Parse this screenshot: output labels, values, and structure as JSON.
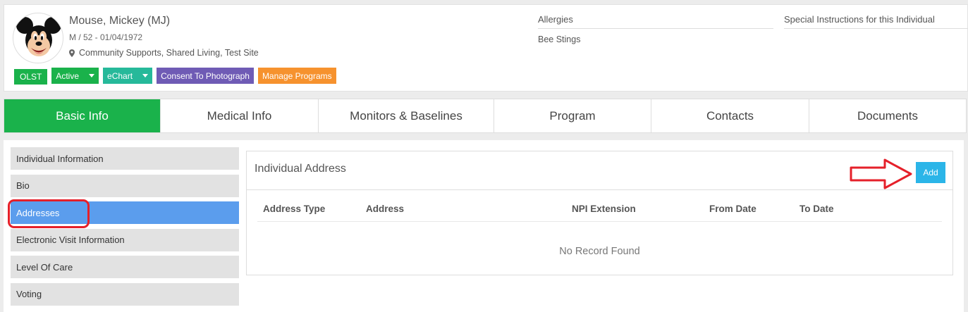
{
  "patient": {
    "name": "Mouse, Mickey (MJ)",
    "demographics": "M  /  52 - 01/04/1972",
    "location": "Community Supports, Shared Living, Test Site"
  },
  "badges": {
    "olst": "OLST",
    "active": "Active",
    "echart": "eChart",
    "consent": "Consent To Photograph",
    "manage": "Manage Programs"
  },
  "allergies": {
    "label": "Allergies",
    "value": "Bee Stings"
  },
  "special_instructions": {
    "label": "Special Instructions for this Individual"
  },
  "tabs": [
    {
      "label": "Basic Info",
      "active": true
    },
    {
      "label": "Medical Info"
    },
    {
      "label": "Monitors & Baselines"
    },
    {
      "label": "Program"
    },
    {
      "label": "Contacts"
    },
    {
      "label": "Documents"
    }
  ],
  "sidebar": {
    "items": [
      {
        "label": "Individual Information"
      },
      {
        "label": "Bio"
      },
      {
        "label": "Addresses",
        "active": true
      },
      {
        "label": "Electronic Visit Information"
      },
      {
        "label": "Level Of Care"
      },
      {
        "label": "Voting"
      }
    ]
  },
  "panel": {
    "title": "Individual Address",
    "add_label": "Add",
    "columns": [
      "Address Type",
      "Address",
      "NPI Extension",
      "From Date",
      "To Date"
    ],
    "empty_text": "No Record Found"
  },
  "colors": {
    "green": "#1ab24b",
    "teal": "#26b99a",
    "purple": "#6f5bb5",
    "orange": "#f6922e",
    "active_sidebar": "#5b9ded",
    "add_button": "#2bb5e8",
    "annotation_red": "#e5202a"
  },
  "icons": {
    "location": "map-marker-icon",
    "avatar": "mickey-mouse-avatar"
  }
}
